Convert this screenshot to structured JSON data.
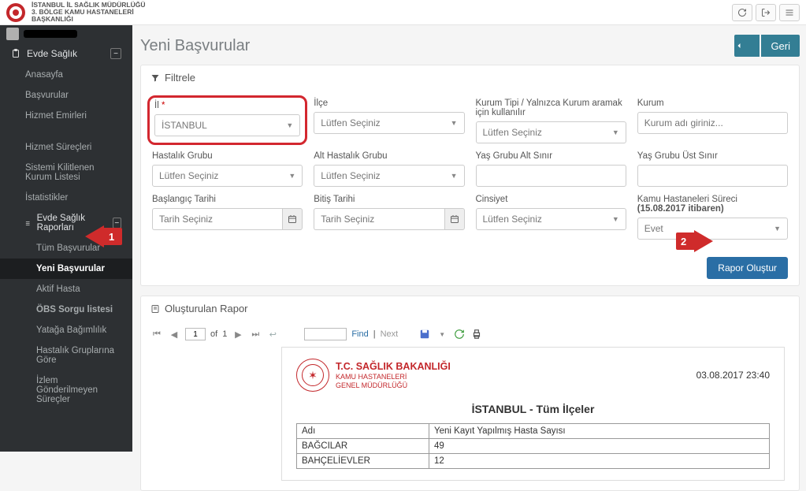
{
  "header": {
    "org_line1": "İSTANBUL İL SAĞLIK MÜDÜRLÜĞÜ",
    "org_line2": "3. BÖLGE KAMU HASTANELERİ",
    "org_line3": "BAŞKANLIĞI"
  },
  "sidebar": {
    "section": "Evde Sağlık",
    "items": {
      "anasayfa": "Anasayfa",
      "basvurular": "Başvurular",
      "hizmet_emirleri": "Hizmet Emirleri",
      "hizmet_surecleri": "Hizmet Süreçleri",
      "sistemi_kilitlenen": "Sistemi Kilitlenen Kurum Listesi",
      "istatistikler": "İstatistikler",
      "raporlar": "Evde Sağlık Raporları",
      "tum_basvurular": "Tüm Başvurular",
      "yeni_basvurular": "Yeni Başvurular",
      "aktif_hasta": "Aktif Hasta",
      "obs_sorgu": "ÖBS Sorgu listesi",
      "yataga_bagimlilik": "Yatağa Bağımlılık",
      "hastalik_gruplarina": "Hastalık Gruplarına Göre",
      "izlem": "İzlem Gönderilmeyen Süreçler"
    }
  },
  "page": {
    "title": "Yeni Başvurular",
    "back": "Geri"
  },
  "filter": {
    "heading": "Filtrele",
    "il_label": "İl",
    "il_value": "İSTANBUL",
    "ilce_label": "İlçe",
    "ilce_value": "Lütfen Seçiniz",
    "kurum_tipi_label": "Kurum Tipi / Yalnızca Kurum aramak için kullanılır",
    "kurum_tipi_value": "Lütfen Seçiniz",
    "kurum_label": "Kurum",
    "kurum_placeholder": "Kurum adı giriniz...",
    "hastalik_grubu_label": "Hastalık Grubu",
    "hastalik_grubu_value": "Lütfen Seçiniz",
    "alt_hastalik_label": "Alt Hastalık Grubu",
    "alt_hastalik_value": "Lütfen Seçiniz",
    "yas_alt_label": "Yaş Grubu Alt Sınır",
    "yas_ust_label": "Yaş Grubu Üst Sınır",
    "baslangic_label": "Başlangıç Tarihi",
    "baslangic_placeholder": "Tarih Seçiniz",
    "bitis_label": "Bitiş Tarihi",
    "bitis_placeholder": "Tarih Seçiniz",
    "cinsiyet_label": "Cinsiyet",
    "cinsiyet_value": "Lütfen Seçiniz",
    "kamu_label": "Kamu Hastaneleri Süreci",
    "kamu_label_note": "(15.08.2017 itibaren)",
    "kamu_value": "Evet",
    "btn_rapor": "Rapor Oluştur"
  },
  "report": {
    "heading": "Oluşturulan Rapor",
    "toolbar": {
      "page": "1",
      "of": "of",
      "total": "1",
      "find": "Find",
      "sep": "|",
      "next": "Next"
    },
    "doc": {
      "title1": "T.C. SAĞLIK BAKANLIĞI",
      "title2": "KAMU HASTANELERİ",
      "title3": "GENEL MÜDÜRLÜĞÜ",
      "datetime": "03.08.2017 23:40",
      "center": "İSTANBUL - Tüm İlçeler",
      "col_adi": "Adı",
      "col_sayi": "Yeni Kayıt Yapılmış Hasta Sayısı",
      "rows": [
        {
          "ad": "BAĞCILAR",
          "v": "49"
        },
        {
          "ad": "BAHÇELİEVLER",
          "v": "12"
        }
      ]
    }
  },
  "arrows": {
    "one": "1",
    "two": "2"
  }
}
